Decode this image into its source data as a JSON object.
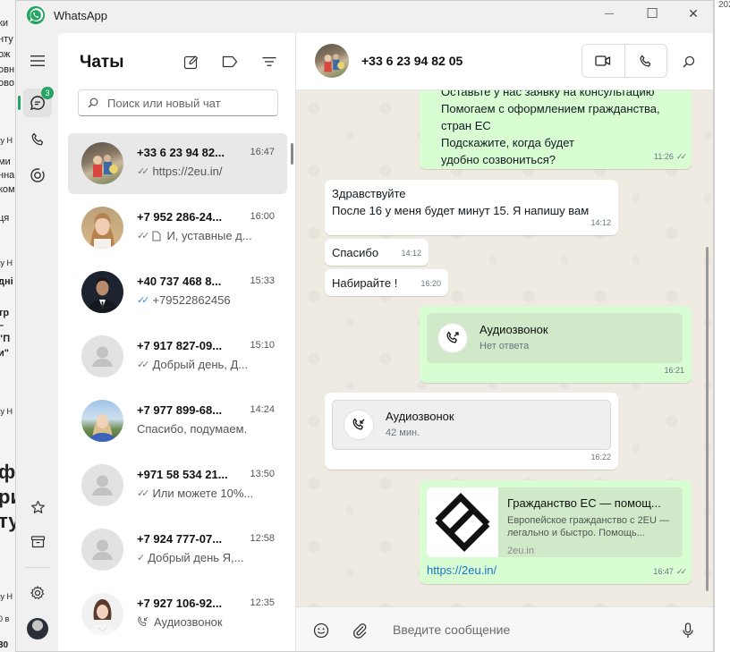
{
  "window": {
    "title": "WhatsApp",
    "controls": {
      "minimize": "—",
      "maximize": "☐",
      "close": "✕"
    }
  },
  "rail": {
    "chats_badge": "3"
  },
  "chat_list": {
    "title": "Чаты",
    "search_placeholder": "Поиск или новый чат",
    "items": [
      {
        "name": "+33 6 23 94 82...",
        "time": "16:47",
        "preview": "https://2eu.in/",
        "tick": "✓✓",
        "tick_color": "#777777"
      },
      {
        "name": "+7 952 286-24...",
        "time": "16:00",
        "preview": "И, уставные д...",
        "tick": "✓✓",
        "tick_color": "#777777",
        "doc_icon": true
      },
      {
        "name": "+40 737 468 8...",
        "time": "15:33",
        "preview": "+79522862456",
        "tick": "✓✓",
        "tick_color": "#3b8ee8"
      },
      {
        "name": "+7 917 827-09...",
        "time": "15:10",
        "preview": "Добрый день, Д...",
        "tick": "✓✓",
        "tick_color": "#777777"
      },
      {
        "name": "+7 977 899-68...",
        "time": "14:24",
        "preview": "Спасибо, подумаем.",
        "tick": "",
        "tick_color": "#777777"
      },
      {
        "name": "+971 58 534 21...",
        "time": "13:50",
        "preview": "Или можете 10%...",
        "tick": "✓✓",
        "tick_color": "#777777"
      },
      {
        "name": "+7 924 777-07...",
        "time": "12:58",
        "preview": "Добрый день Я,...",
        "tick": "✓",
        "tick_color": "#777777"
      },
      {
        "name": "+7 927 106-92...",
        "time": "12:35",
        "preview": "Аудиозвонок",
        "tick": "",
        "tick_color": "#777777"
      }
    ]
  },
  "conversation": {
    "contact": "+33 6 23 94 82 05",
    "messages": [
      {
        "id": "m1",
        "dir": "out",
        "text": "Оставьте у нас заявку на консультацию\nПомогаем с оформлением гражданства,\nстран ЕС\nПодскажите, когда будет\nудобно созвониться?",
        "time": "11:26",
        "tick": "✓✓"
      },
      {
        "id": "m2",
        "dir": "in",
        "text": "Здравствуйте\nПосле 16 у меня будет минут 15. Я напишу вам",
        "time": "14:12"
      },
      {
        "id": "m3",
        "dir": "in",
        "text": "Спасибо",
        "time": "14:12"
      },
      {
        "id": "m4",
        "dir": "in",
        "text": "Набирайте !",
        "time": "16:20"
      }
    ],
    "call_out": {
      "title": "Аудиозвонок",
      "subtitle": "Нет ответа",
      "time": "16:21"
    },
    "call_in": {
      "title": "Аудиозвонок",
      "subtitle": "42 мин.",
      "time": "16:22"
    },
    "link_message": {
      "title": "Гражданство ЕС — помощ...",
      "description": "Европейское гражданство с 2EU — легально и быстро. Помощь...",
      "domain": "2eu.in",
      "url": "https://2eu.in/",
      "time": "16:47",
      "tick": "✓✓"
    },
    "compose_placeholder": "Введите сообщение"
  },
  "colors": {
    "accent": "#25a464",
    "outgoing_bubble": "#d9fdd3",
    "chat_background": "#efeae2",
    "read_tick": "#3b8ee8"
  }
}
